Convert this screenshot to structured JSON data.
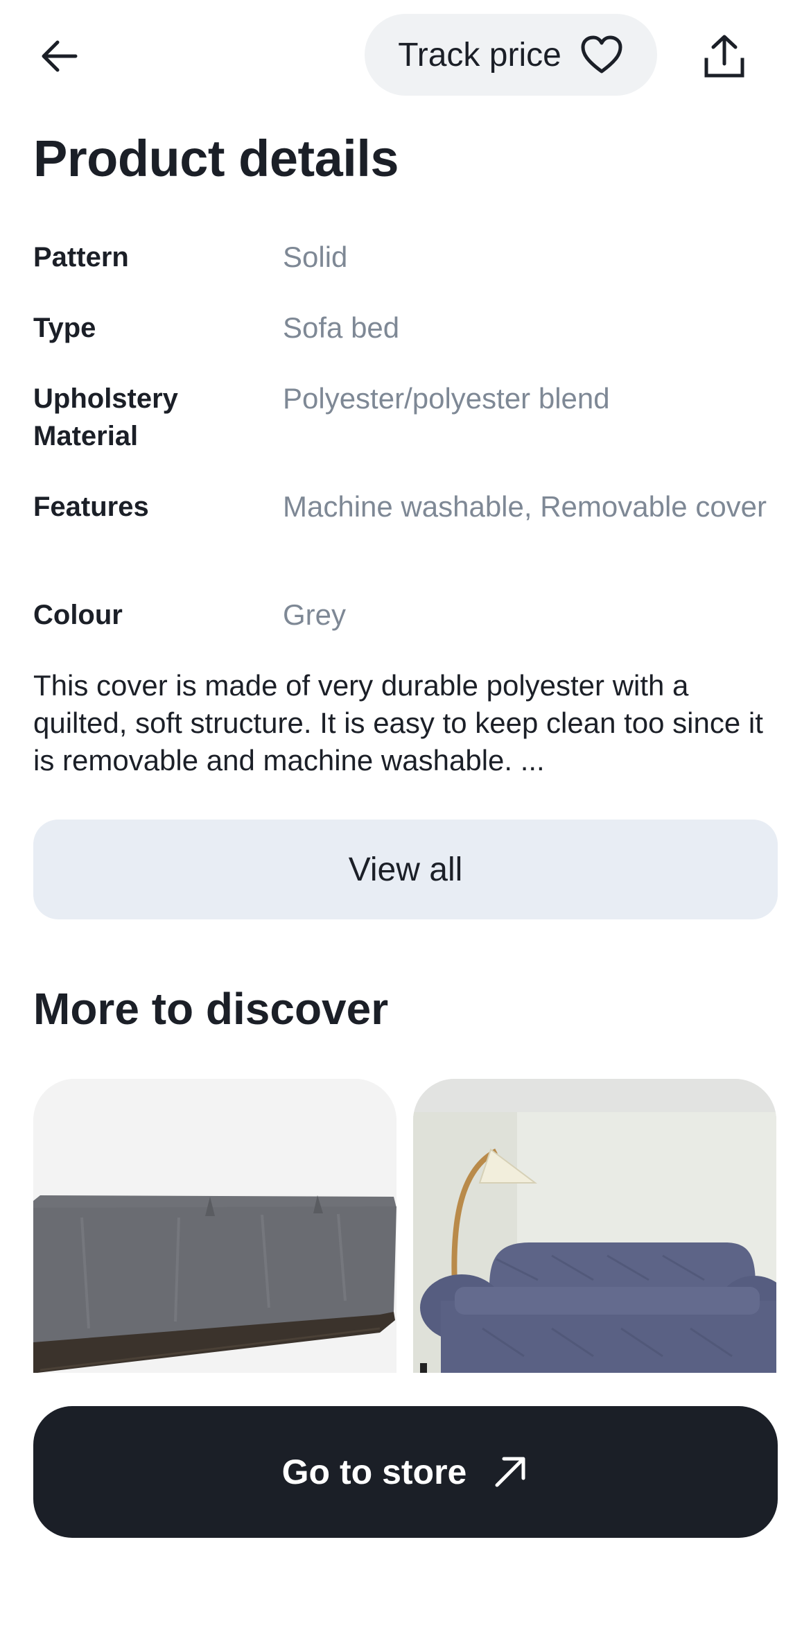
{
  "header": {
    "back_icon": "arrow-left-icon",
    "track_price_label": "Track price",
    "track_icon": "heart-icon",
    "share_icon": "share-upload-icon"
  },
  "product_details": {
    "title": "Product details",
    "rows": [
      {
        "label": "Pattern",
        "value": "Solid"
      },
      {
        "label": "Type",
        "value": "Sofa bed"
      },
      {
        "label": "Upholstery Material",
        "value": "Polyester/polyester blend"
      },
      {
        "label": "Features",
        "value": "Machine washable, Removable cover"
      },
      {
        "label": "Colour",
        "value": "Grey"
      }
    ],
    "description": "This cover is made of very durable polyester with a quilted, soft structure. It is easy to keep clean too since it is removable and machine washable. ...",
    "view_all_label": "View all"
  },
  "discover": {
    "title": "More to discover",
    "items": [
      {
        "image": "grey-furniture-cover-image"
      },
      {
        "image": "blue-sofa-with-lamp-image"
      }
    ]
  },
  "footer": {
    "go_to_store_label": "Go to store",
    "go_to_store_icon": "arrow-up-right-icon"
  },
  "colors": {
    "text_primary": "#1b1f27",
    "text_muted": "#7e8895",
    "pill_bg": "#f0f2f4",
    "view_all_bg": "#e8edf4",
    "store_button_bg": "#1b1f27"
  }
}
